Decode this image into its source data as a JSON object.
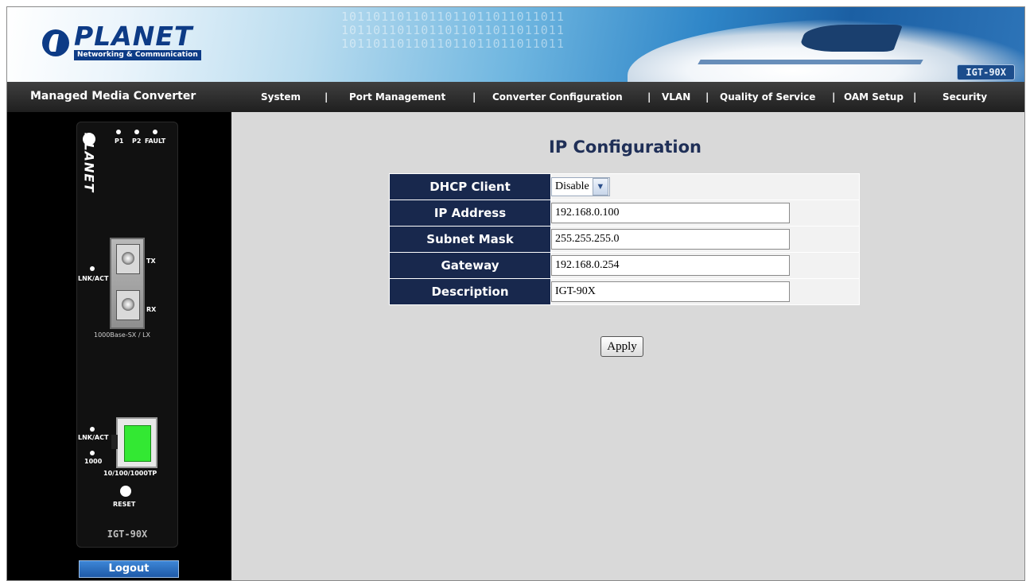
{
  "header": {
    "logo_name": "PLANET",
    "logo_tagline": "Networking & Communication",
    "model_tag": "IGT-90X",
    "binary_pattern": "1011011011011011011011011011"
  },
  "nav": {
    "brand": "Managed Media Converter",
    "items": [
      "System",
      "Port Management",
      "Converter Configuration",
      "VLAN",
      "Quality of Service",
      "OAM Setup",
      "Security"
    ],
    "separator": "|"
  },
  "device": {
    "leds": [
      "P1",
      "P2",
      "FAULT"
    ],
    "logo": "PLANET",
    "fiber_status": "LNK/ACT",
    "tx": "TX",
    "rx": "RX",
    "fiber_type": "1000Base-SX / LX",
    "copper_status": "LNK/ACT",
    "copper_speed": "1000",
    "copper_type": "10/100/1000TP",
    "reset": "RESET",
    "model": "IGT-90X"
  },
  "sidebar": {
    "logout_label": "Logout"
  },
  "main": {
    "title": "IP Configuration",
    "rows": [
      {
        "label": "DHCP Client",
        "value": "Disable"
      },
      {
        "label": "IP Address",
        "value": "192.168.0.100"
      },
      {
        "label": "Subnet Mask",
        "value": "255.255.255.0"
      },
      {
        "label": "Gateway",
        "value": "192.168.0.254"
      },
      {
        "label": "Description",
        "value": "IGT-90X"
      }
    ],
    "apply_label": "Apply"
  },
  "colors": {
    "nav_bg": "#2a2a2a",
    "label_bg": "#18284d",
    "title_color": "#1f2f57",
    "content_bg": "#d9d9d9",
    "logout_bg": "#2a6cc0"
  }
}
